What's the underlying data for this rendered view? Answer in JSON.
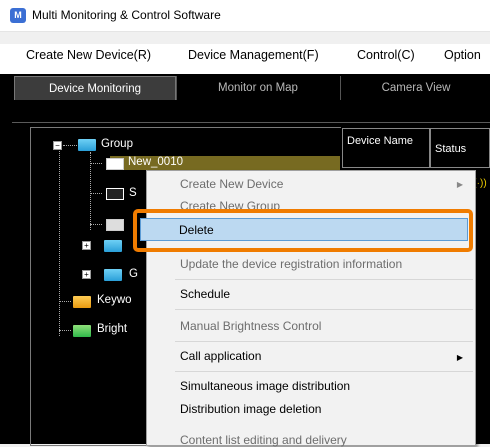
{
  "window": {
    "title": "Multi Monitoring & Control Software"
  },
  "menubar": [
    "Create New Device(R)",
    "Device Management(F)",
    "Control(C)",
    "Option"
  ],
  "tabs": [
    "Device Monitoring",
    "Monitor on Map",
    "Camera View"
  ],
  "tree": {
    "root": "Group",
    "device_partial": "New_0010",
    "child_s": "S",
    "child_g": "G",
    "keyword": "Keywo",
    "bright": "Bright"
  },
  "table": {
    "col_device": "Device Name",
    "col_status": "Status"
  },
  "context_menu": {
    "items": [
      "Create New Device",
      "Create New Group",
      "Delete",
      "Update the device registration information",
      "Schedule",
      "Manual Brightness Control",
      "Call application",
      "Simultaneous image distribution",
      "Distribution image deletion",
      "Content list editing and delivery"
    ]
  },
  "colors": {
    "highlight_frame": "#f07c00",
    "selection": "#bcd9f1",
    "tab_bg": "#000000"
  }
}
